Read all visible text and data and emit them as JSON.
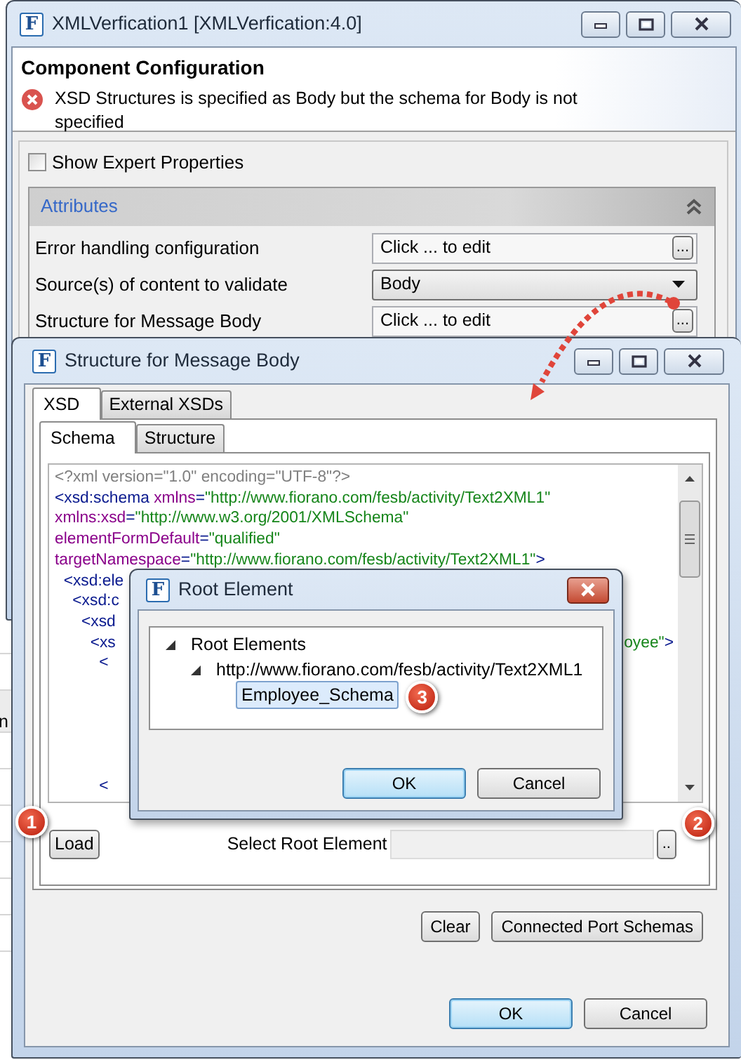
{
  "background_table": {
    "header_text": "n"
  },
  "main_window": {
    "icon_letter": "F",
    "title": "XMLVerfication1 [XMLVerfication:4.0]",
    "heading": "Component Configuration",
    "error": {
      "message": "XSD Structures is specified as Body but the schema for Body is not specified"
    },
    "show_expert_properties": {
      "label": "Show Expert Properties",
      "checked": false
    },
    "section": {
      "title": "Attributes",
      "expanded": true,
      "rows": [
        {
          "label": "Error handling configuration",
          "kind": "editor",
          "value": "Click ... to edit",
          "button": "..."
        },
        {
          "label": "Source(s) of content to validate",
          "kind": "dropdown",
          "value": "Body"
        },
        {
          "label": "Structure for Message Body",
          "kind": "editor",
          "value": "Click ... to edit",
          "button": "..."
        }
      ]
    }
  },
  "structure_window": {
    "icon_letter": "F",
    "title": "Structure for Message Body",
    "tabs": [
      {
        "label": "XSD",
        "selected": true
      },
      {
        "label": "External XSDs",
        "selected": false
      }
    ],
    "subtabs": [
      {
        "label": "Schema",
        "selected": true
      },
      {
        "label": "Structure",
        "selected": false
      }
    ],
    "code_lines": [
      {
        "parts": [
          [
            {
              "kind": "decl",
              "text": "<?xml version=\"1.0\" encoding=\"UTF-8\"?>"
            }
          ]
        ]
      },
      {
        "parts": [
          [
            {
              "kind": "tag",
              "text": "<xsd:schema "
            },
            {
              "kind": "attr",
              "text": "xmlns"
            },
            {
              "kind": "tag",
              "text": "="
            },
            {
              "kind": "value",
              "text": "\"http://www.fiorano.com/fesb/activity/Text2XML1\""
            }
          ]
        ]
      },
      {
        "parts": [
          [
            {
              "kind": "attr",
              "text": "xmlns:xsd"
            },
            {
              "kind": "tag",
              "text": "="
            },
            {
              "kind": "value",
              "text": "\"http://www.w3.org/2001/XMLSchema\""
            }
          ]
        ]
      },
      {
        "parts": [
          [
            {
              "kind": "attr",
              "text": "elementFormDefault"
            },
            {
              "kind": "tag",
              "text": "="
            },
            {
              "kind": "value",
              "text": "\"qualified\""
            }
          ]
        ]
      },
      {
        "parts": [
          [
            {
              "kind": "attr",
              "text": "targetNamespace"
            },
            {
              "kind": "tag",
              "text": "="
            },
            {
              "kind": "value",
              "text": "\"http://www.fiorano.com/fesb/activity/Text2XML1\""
            },
            {
              "kind": "tag",
              "text": ">"
            }
          ]
        ]
      },
      {
        "parts": [
          [
            {
              "kind": "tag",
              "text": "  <xsd:ele"
            }
          ]
        ]
      },
      {
        "parts": [
          [
            {
              "kind": "tag",
              "text": "    <xsd:c"
            }
          ]
        ]
      },
      {
        "parts": [
          [
            {
              "kind": "tag",
              "text": "      <xsd"
            }
          ]
        ]
      },
      {
        "parts": [
          [
            {
              "kind": "tag",
              "text": "        <xs"
            }
          ],
          [
            {
              "kind": "value",
              "text": "oyee\""
            },
            {
              "kind": "tag",
              "text": ">"
            }
          ]
        ]
      },
      {
        "parts": [
          [
            {
              "kind": "tag",
              "text": "          <"
            }
          ]
        ]
      },
      {
        "parts": [
          [
            {
              "kind": "tag",
              "text": "          <"
            }
          ]
        ]
      }
    ],
    "load_button": {
      "label": "Load",
      "callout": "1"
    },
    "root_label": "Select Root Element",
    "root_button": {
      "label": "..",
      "callout": "2"
    },
    "schema_buttons": [
      {
        "label": "Clear",
        "default": false
      },
      {
        "label": "Connected Port Schemas",
        "default": false
      }
    ],
    "dialog_buttons": [
      {
        "label": "OK",
        "default": true
      },
      {
        "label": "Cancel",
        "default": false
      }
    ]
  },
  "root_dialog": {
    "icon_letter": "F",
    "title": "Root Element",
    "tree": [
      {
        "label": "Root Elements",
        "expanded": true,
        "selected": false,
        "children": [
          {
            "label": "http://www.fiorano.com/fesb/activity/Text2XML1",
            "expanded": true,
            "selected": false,
            "children": [
              {
                "label": "Employee_Schema",
                "selected": true,
                "callout": "3"
              }
            ]
          }
        ]
      }
    ],
    "buttons": [
      {
        "label": "OK",
        "default": true
      },
      {
        "label": "Cancel",
        "default": false
      }
    ]
  }
}
